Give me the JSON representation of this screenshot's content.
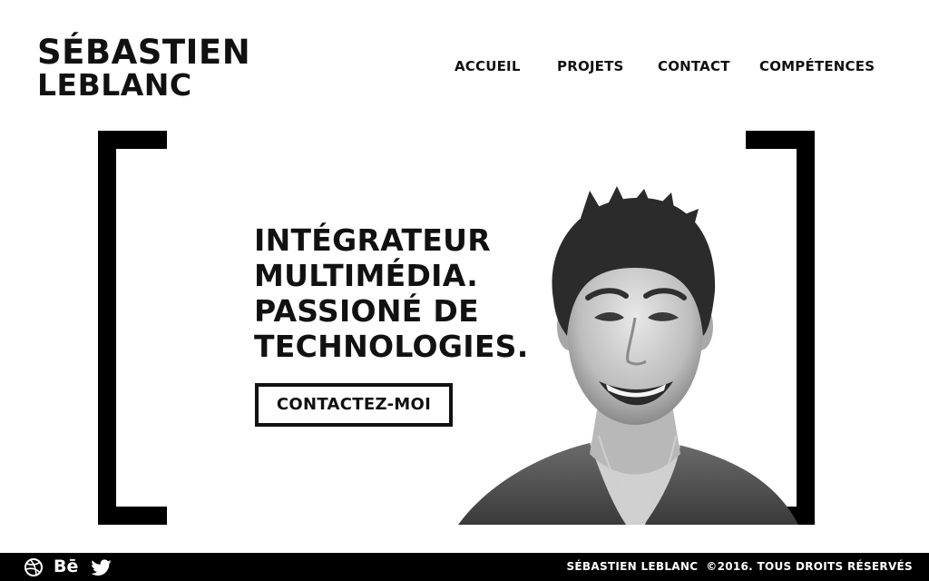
{
  "brand": {
    "line1": "SÉBASTIEN",
    "line2": "LEBLANC"
  },
  "nav": {
    "items": [
      {
        "label": "ACCUEIL"
      },
      {
        "label": "PROJETS"
      },
      {
        "label": "CONTACT"
      },
      {
        "label": "COMPÉTENCES"
      }
    ]
  },
  "hero": {
    "lines": [
      "INTÉGRATEUR",
      "MULTIMÉDIA.",
      "PASSIONÉ DE",
      "TECHNOLOGIES."
    ],
    "cta_label": "CONTACTEZ-MOI"
  },
  "footer": {
    "social": [
      "dribbble-icon",
      "behance-icon",
      "twitter-icon"
    ],
    "behance_text": "Bē",
    "copyright": "SÉBASTIEN LEBLANC  ©2016. TOUS DROITS RÉSERVÉS"
  },
  "colors": {
    "background": "#ffffff",
    "text": "#111111",
    "footer": "#000000"
  }
}
